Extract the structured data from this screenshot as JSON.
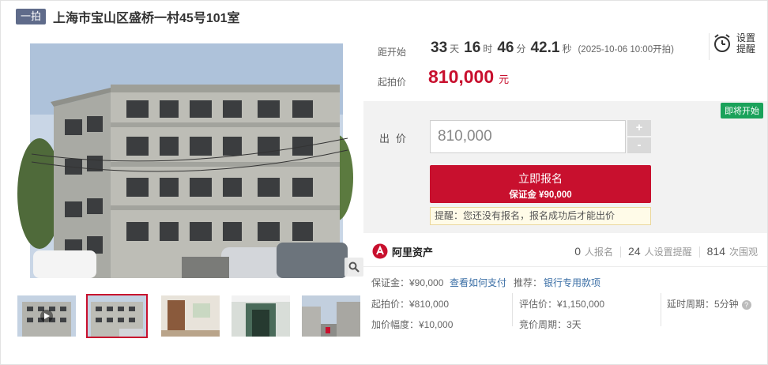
{
  "header": {
    "tag": "一拍",
    "title": "上海市宝山区盛桥一村45号101室"
  },
  "countdown": {
    "label": "距开始",
    "days": "33",
    "days_unit": "天",
    "hours": "16",
    "hours_unit": "时",
    "minutes": "46",
    "minutes_unit": "分",
    "seconds": "42.1",
    "seconds_unit": "秒",
    "start_note": "(2025-10-06 10:00开拍)"
  },
  "reminder": {
    "label": "设置提醒",
    "icon": "alarm-clock-icon"
  },
  "starting_price": {
    "label": "起拍价",
    "value": "810,000",
    "unit": "元"
  },
  "bid": {
    "badge": "即将开始",
    "label": "出价",
    "input_value": "810,000",
    "plus": "+",
    "minus": "-",
    "signup_label": "立即报名",
    "deposit_label": "保证金 ¥90,000",
    "tip": "提醒：您还没有报名，报名成功后才能出价"
  },
  "provider": {
    "name": "阿里资产",
    "signups": "0",
    "signups_label": "人报名",
    "reminders": "24",
    "reminders_label": "人设置提醒",
    "views": "814",
    "views_label": "次围观"
  },
  "info": {
    "deposit_label": "保证金：¥90,000",
    "payment_link": "查看如何支付",
    "recommend_label": "推荐：",
    "loan_link": "银行专用款项",
    "start_price_label": "起拍价：¥810,000",
    "increment_label": "加价幅度：¥10,000",
    "appraisal_label": "评估价：¥1,150,000",
    "cycle_label": "竞价周期：3天",
    "delay_label": "延时周期：5分钟"
  },
  "colors": {
    "accent_red": "#c8102e",
    "tag_bg": "#5f6b8a",
    "badge_green": "#1aa25a",
    "link_blue": "#3a6ea5"
  }
}
